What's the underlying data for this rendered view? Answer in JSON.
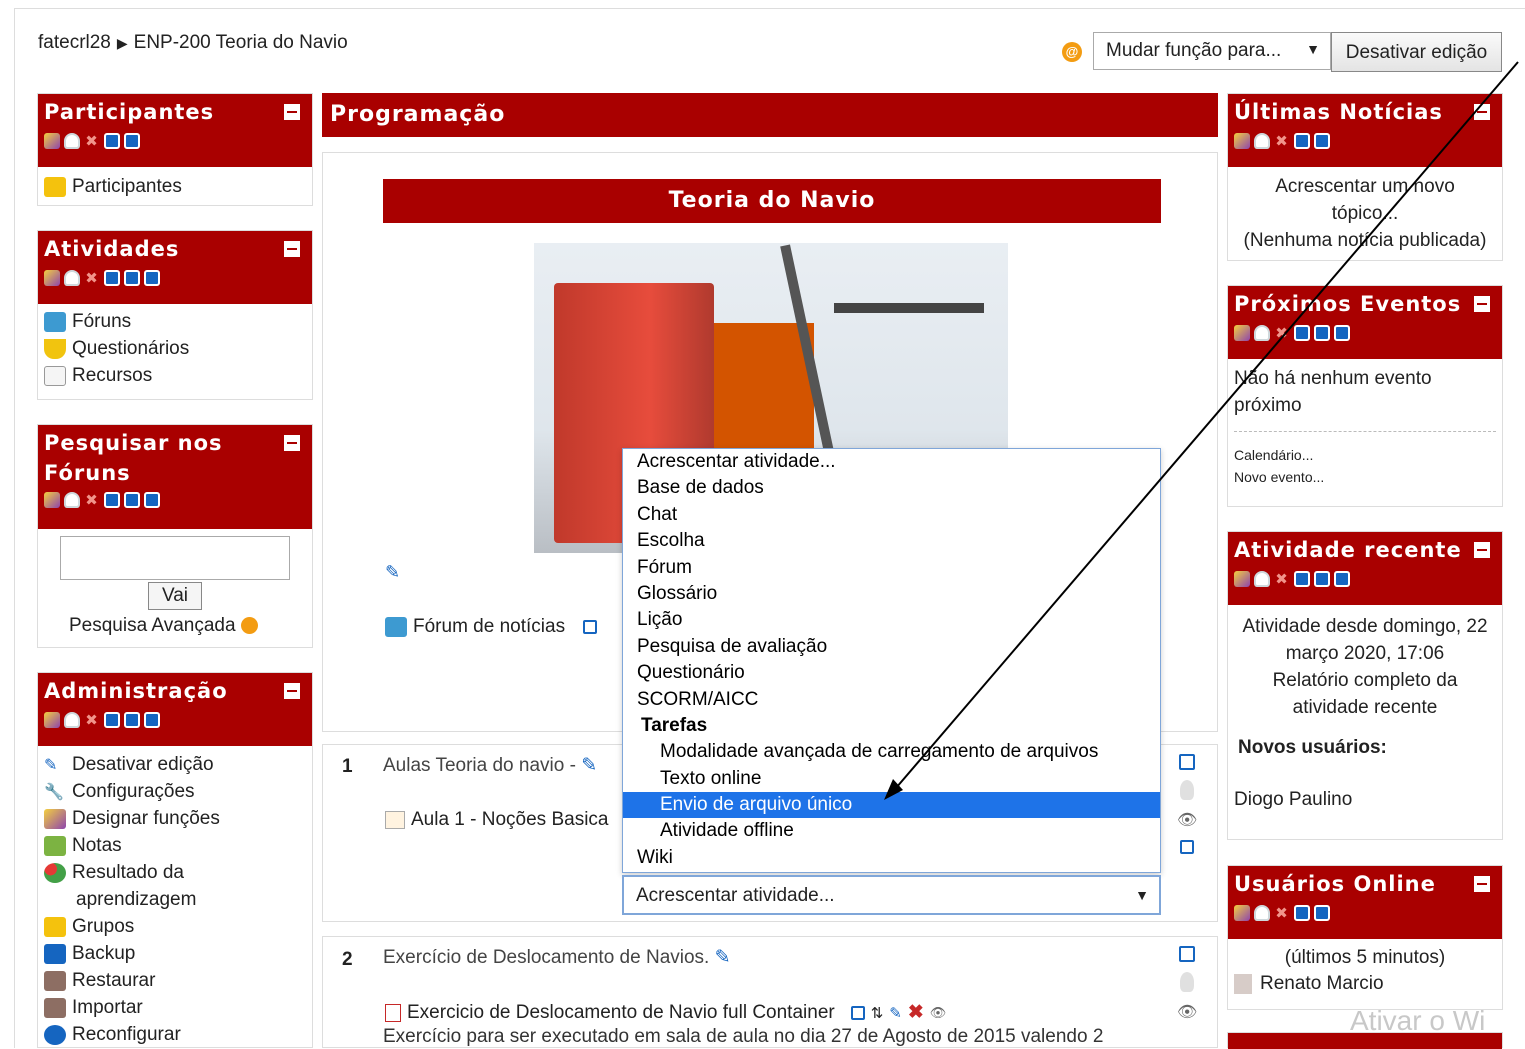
{
  "breadcrumb": {
    "home": "fatecrl28",
    "separator": "▶",
    "course": "ENP-200 Teoria do Navio"
  },
  "header": {
    "role_select": "Mudar função para...",
    "edit_button": "Desativar edição"
  },
  "left": {
    "participants": {
      "title": "Participantes",
      "items": [
        "Participantes"
      ]
    },
    "activities": {
      "title": "Atividades",
      "items": [
        "Fóruns",
        "Questionários",
        "Recursos"
      ]
    },
    "search": {
      "title_line1": "Pesquisar nos",
      "title_line2": "Fóruns",
      "button": "Vai",
      "advanced": "Pesquisa Avançada"
    },
    "admin": {
      "title": "Administração",
      "items": [
        "Desativar edição",
        "Configurações",
        "Designar funções",
        "Notas",
        "Resultado da",
        "aprendizagem",
        "Grupos",
        "Backup",
        "Restaurar",
        "Importar",
        "Reconfigurar"
      ]
    }
  },
  "center": {
    "title": "Programação",
    "banner": "Teoria do Navio",
    "news_forum": "Fórum de notícias",
    "section1": {
      "num": "1",
      "title": "Aulas Teoria do navio -",
      "item": "Aula 1 - Noções Basica"
    },
    "section2": {
      "num": "2",
      "title": "Exercício de Deslocamento de Navios.",
      "item": "Exercicio de Deslocamento de Navio full Container",
      "desc": "Exercício para ser executado em sala de aula no dia 27 de Agosto de 2015 valendo 2"
    },
    "dropdown": {
      "options": [
        "Acrescentar atividade...",
        "Base de dados",
        "Chat",
        "Escolha",
        "Fórum",
        "Glossário",
        "Lição",
        "Pesquisa de avaliação",
        "Questionário",
        "SCORM/AICC"
      ],
      "group": "Tarefas",
      "sub_options": [
        "Modalidade avançada de carregamento de arquivos",
        "Texto online",
        "Envio de arquivo único",
        "Atividade offline"
      ],
      "last": "Wiki",
      "selected": "Envio de arquivo único",
      "value": "Acrescentar atividade..."
    }
  },
  "right": {
    "news": {
      "title": "Últimas Notícias",
      "add_line1": "Acrescentar um novo",
      "add_line2": "tópico...",
      "none": "(Nenhuma notícia publicada)"
    },
    "events": {
      "title": "Próximos Eventos",
      "none_line1": "Não há nenhum evento",
      "none_line2": "próximo",
      "calendar": "Calendário...",
      "new_event": "Novo evento..."
    },
    "recent": {
      "title": "Atividade recente",
      "since_line1": "Atividade desde domingo, 22",
      "since_line2": "março 2020, 17:06",
      "report_line1": "Relatório completo da",
      "report_line2": "atividade recente",
      "new_users": "Novos usuários:",
      "user": "Diogo Paulino"
    },
    "online": {
      "title": "Usuários Online",
      "window": "(últimos 5 minutos)",
      "user": "Renato Marcio"
    }
  },
  "watermark": "Ativar o Wi",
  "colors": {
    "brand": "#a90000",
    "selection": "#1e73e8"
  }
}
